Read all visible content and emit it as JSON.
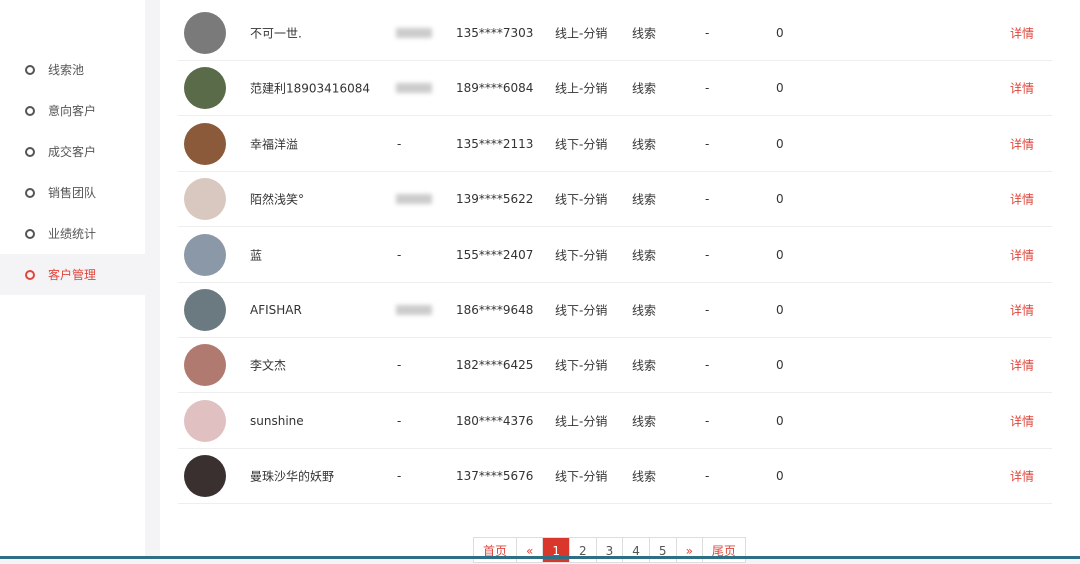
{
  "sidebar": {
    "items": [
      {
        "label": "线索池"
      },
      {
        "label": "意向客户"
      },
      {
        "label": "成交客户"
      },
      {
        "label": "销售团队"
      },
      {
        "label": "业绩统计"
      },
      {
        "label": "客户管理",
        "active": true
      }
    ]
  },
  "rows": [
    {
      "name": "不可一世.",
      "extra": null,
      "phone": "135****7303",
      "channel": "线上-分销",
      "type": "线索",
      "dash": "-",
      "count": "0",
      "detail": "详情",
      "avatar_color": "#7a7a7a"
    },
    {
      "name": "范建利18903416084",
      "extra": null,
      "phone": "189****6084",
      "channel": "线上-分销",
      "type": "线索",
      "dash": "-",
      "count": "0",
      "detail": "详情",
      "avatar_color": "#5a6b4a"
    },
    {
      "name": "幸福洋溢",
      "extra": "-",
      "phone": "135****2113",
      "channel": "线下-分销",
      "type": "线索",
      "dash": "-",
      "count": "0",
      "detail": "详情",
      "avatar_color": "#8a5a3a"
    },
    {
      "name": "陌然浅笑°",
      "extra": null,
      "phone": "139****5622",
      "channel": "线下-分销",
      "type": "线索",
      "dash": "-",
      "count": "0",
      "detail": "详情",
      "avatar_color": "#d8c8c0"
    },
    {
      "name": "蓝",
      "extra": "-",
      "phone": "155****2407",
      "channel": "线下-分销",
      "type": "线索",
      "dash": "-",
      "count": "0",
      "detail": "详情",
      "avatar_color": "#8a98a8"
    },
    {
      "name": "AFISHAR",
      "extra": null,
      "phone": "186****9648",
      "channel": "线下-分销",
      "type": "线索",
      "dash": "-",
      "count": "0",
      "detail": "详情",
      "avatar_color": "#6a7a80"
    },
    {
      "name": "李文杰",
      "extra": "-",
      "phone": "182****6425",
      "channel": "线下-分销",
      "type": "线索",
      "dash": "-",
      "count": "0",
      "detail": "详情",
      "avatar_color": "#b07a70"
    },
    {
      "name": "sunshine",
      "extra": "-",
      "phone": "180****4376",
      "channel": "线上-分销",
      "type": "线索",
      "dash": "-",
      "count": "0",
      "detail": "详情",
      "avatar_color": "#e0c0c0"
    },
    {
      "name": "曼珠沙华的妖野",
      "extra": "-",
      "phone": "137****5676",
      "channel": "线下-分销",
      "type": "线索",
      "dash": "-",
      "count": "0",
      "detail": "详情",
      "avatar_color": "#3a3030"
    }
  ],
  "pager": {
    "first": "首页",
    "prev": "«",
    "pages": [
      "1",
      "2",
      "3",
      "4",
      "5"
    ],
    "current": "1",
    "next": "»",
    "last": "尾页"
  }
}
